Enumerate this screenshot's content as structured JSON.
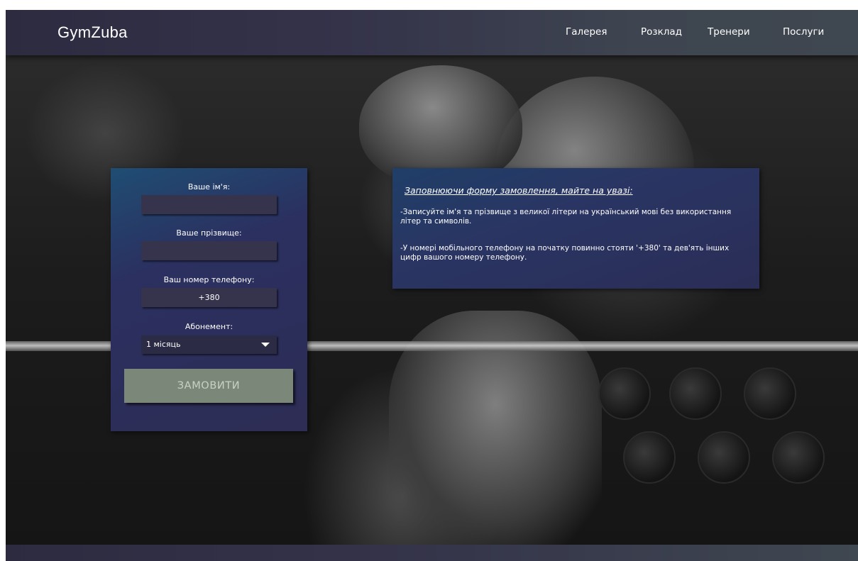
{
  "header": {
    "logo": "GymZuba",
    "nav": [
      {
        "label": "Галерея"
      },
      {
        "label": "Розклад"
      },
      {
        "label": "Тренери"
      },
      {
        "label": "Послуги"
      }
    ]
  },
  "form": {
    "name_label": "Ваше ім'я:",
    "name_value": "",
    "surname_label": "Ваше прізвище:",
    "surname_value": "",
    "phone_label": "Ваш номер телефону:",
    "phone_value": "+380",
    "subscription_label": "Абонемент:",
    "subscription_value": "1 місяць",
    "submit_label": "ЗАМОВИТИ"
  },
  "info": {
    "title": "Заповнюючи форму замовлення, майте на увазі:",
    "rule_1": " -Записуйте ім'я та прізвище з великої літери на український мові без використання літер та символів.",
    "rule_2": " -У номері мобільного телефону на початку повинно стояти '+380' та дев'ять інших цифр вашого номеру телефону."
  },
  "colors": {
    "header_bg": "#34334a",
    "form_bg": "#2b3060",
    "input_bg": "#35344c",
    "button_bg": "#7b8879",
    "text": "#ffffff"
  }
}
